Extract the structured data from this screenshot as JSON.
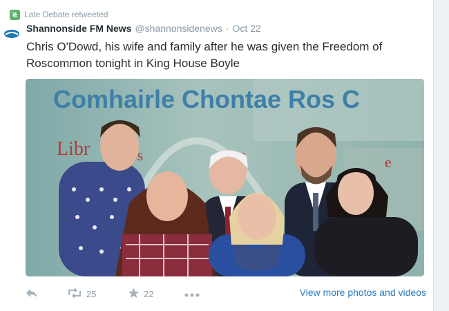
{
  "context": {
    "retweeter": "Late Debate retweeted"
  },
  "tweet": {
    "author_name": "Shannonside FM News",
    "handle": "@shannonsidenews",
    "separator": "·",
    "date": "Oct 22",
    "text": "Chris O'Dowd,  his wife and family after he was given the Freedom of Roscommon tonight in King House Boyle"
  },
  "media": {
    "banner_text": "Comhairle Chontae Ros C",
    "banner_text_2": "Libr",
    "banner_text_3": "es",
    "banner_text_4": "s",
    "banner_text_5": "e"
  },
  "actions": {
    "reply": "",
    "retweet_count": "25",
    "favorite_count": "22",
    "view_more": "View more photos and videos"
  },
  "colors": {
    "accent_link": "#2b7bb9",
    "meta_gray": "#8899a6",
    "retweet_green": "#5eb26a"
  }
}
